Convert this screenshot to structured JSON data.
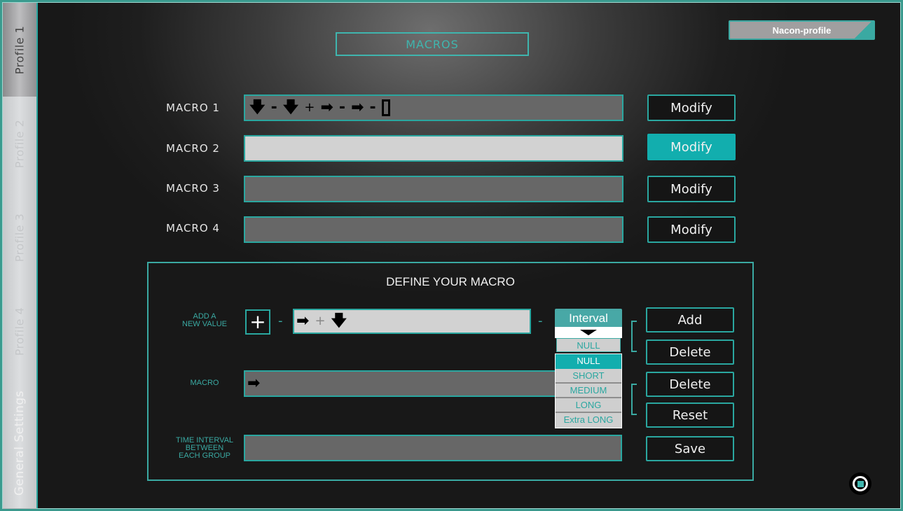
{
  "sidebar": {
    "tabs": [
      {
        "label": "Profile 1",
        "active": true
      },
      {
        "label": "Profile 2",
        "active": false
      },
      {
        "label": "Profile 3",
        "active": false
      },
      {
        "label": "Profile 4",
        "active": false
      },
      {
        "label": "General Settings",
        "active": false
      }
    ]
  },
  "header": {
    "title": "MACROS",
    "profile_name": "Nacon-profile"
  },
  "macros": [
    {
      "label": "MACRO 1",
      "sequence": [
        "down-arrow",
        "-",
        "down-arrow",
        "+",
        "right-arrow",
        "-",
        "right-arrow",
        "-",
        "rectangle-button"
      ],
      "button": "Modify"
    },
    {
      "label": "MACRO 2",
      "sequence": [],
      "button": "Modify",
      "selected": true
    },
    {
      "label": "MACRO 3",
      "sequence": [],
      "button": "Modify"
    },
    {
      "label": "MACRO 4",
      "sequence": [],
      "button": "Modify"
    }
  ],
  "define": {
    "title": "DEFINE YOUR MACRO",
    "add_label_1": "ADD A",
    "add_label_2": "NEW VALUE",
    "plus_symbol": "+",
    "dash": "-",
    "new_value_sequence": [
      "right-arrow",
      "+",
      "down-arrow"
    ],
    "interval": {
      "label": "Interval",
      "selected": "NULL",
      "options": [
        "NULL",
        "SHORT",
        "MEDIUM",
        "LONG",
        "Extra LONG"
      ],
      "highlighted": "NULL"
    },
    "macro_label": "MACRO",
    "macro_sequence": [
      "right-arrow"
    ],
    "time_label_1": "TIME INTERVAL",
    "time_label_2": "BETWEEN",
    "time_label_3": "EACH GROUP",
    "buttons": {
      "add": "Add",
      "delete_value": "Delete",
      "delete_macro": "Delete",
      "reset": "Reset",
      "save": "Save"
    }
  },
  "glyphs": {
    "down_arrow": "🡇",
    "right_arrow": "➡",
    "plus": "+",
    "minus": "-"
  },
  "colors": {
    "accent": "#2aa7a0",
    "active_button": "#12aeae",
    "frame": "#3a9a8e"
  }
}
